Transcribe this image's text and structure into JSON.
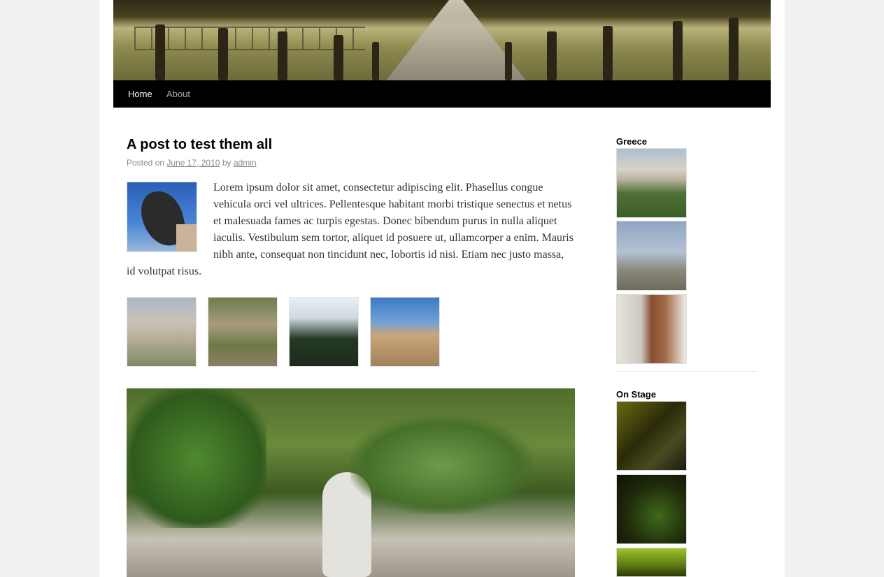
{
  "header": {
    "image_name": "header-landscape-avenue"
  },
  "nav": {
    "items": [
      {
        "label": "Home",
        "active": true
      },
      {
        "label": "About",
        "active": false
      }
    ]
  },
  "post": {
    "title": "A post to test them all",
    "meta": {
      "posted_on": "Posted on",
      "date": "June 17, 2010",
      "by": "by",
      "author": "admin"
    },
    "body": "Lorem ipsum dolor sit amet, consectetur adipiscing elit. Phasellus congue vehicula orci vel ultrices. Pellentesque habitant morbi tristique senectus et netus et malesuada fames ac turpis egestas. Donec bibendum purus in nulla aliquet iaculis. Vestibulum sem tortor, aliquet id posuere ut, ullamcorper a enim. Mauris nibh ante, consequat non tincidunt nec, lobortis id nisi. Etiam nec justo massa, id volutpat risus."
  },
  "sidebar": {
    "widgets": [
      {
        "title": "Greece"
      },
      {
        "title": "On Stage"
      }
    ]
  }
}
